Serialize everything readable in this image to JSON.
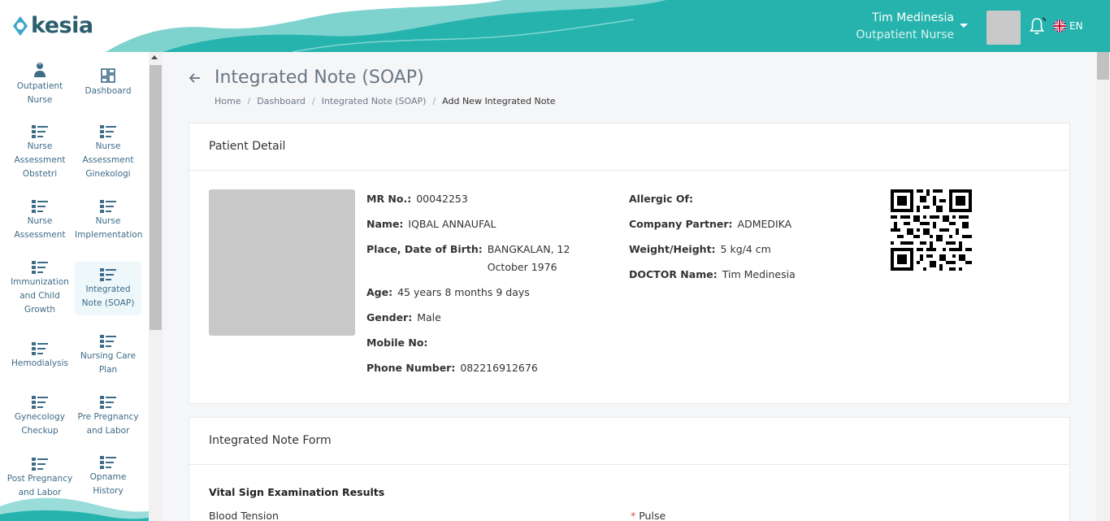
{
  "header": {
    "logo_text": "kesia",
    "user_name": "Tim Medinesia",
    "user_role": "Outpatient Nurse",
    "language": "EN",
    "colors": {
      "teal": "#27b3ad",
      "teal_light": "#7fd3cf"
    }
  },
  "sidebar": {
    "items": [
      {
        "label": "Outpatient Nurse",
        "icon": "nurse-icon",
        "active": false
      },
      {
        "label": "Dashboard",
        "icon": "dashboard-icon",
        "active": false
      },
      {
        "label": "Nurse Assessment Obstetri",
        "icon": "list-icon",
        "active": false
      },
      {
        "label": "Nurse Assessment Ginekologi",
        "icon": "list-icon",
        "active": false
      },
      {
        "label": "Nurse Assessment",
        "icon": "list-icon",
        "active": false
      },
      {
        "label": "Nurse Implementation",
        "icon": "list-icon",
        "active": false
      },
      {
        "label": "Immunization and Child Growth",
        "icon": "list-icon",
        "active": false
      },
      {
        "label": "Integrated Note (SOAP)",
        "icon": "list-icon",
        "active": true
      },
      {
        "label": "Hemodialysis",
        "icon": "list-icon",
        "active": false
      },
      {
        "label": "Nursing Care Plan",
        "icon": "list-icon",
        "active": false
      },
      {
        "label": "Gynecology Checkup",
        "icon": "list-icon",
        "active": false
      },
      {
        "label": "Pre Pregnancy and Labor",
        "icon": "list-icon",
        "active": false
      },
      {
        "label": "Post Pregnancy and Labor",
        "icon": "list-icon",
        "active": false
      },
      {
        "label": "Opname History",
        "icon": "list-icon",
        "active": false
      }
    ]
  },
  "page": {
    "title": "Integrated Note (SOAP)",
    "breadcrumb": [
      "Home",
      "Dashboard",
      "Integrated Note (SOAP)",
      "Add New Integrated Note"
    ]
  },
  "patient_card": {
    "title": "Patient Detail",
    "left_fields": [
      {
        "key": "MR No.:",
        "value": "00042253"
      },
      {
        "key": "Name:",
        "value": "IQBAL ANNAUFAL"
      },
      {
        "key": "Place, Date of Birth:",
        "value": "BANGKALAN, 12 October 1976"
      },
      {
        "key": "Age:",
        "value": "45 years 8 months 9 days"
      },
      {
        "key": "Gender:",
        "value": "Male"
      },
      {
        "key": "Mobile No:",
        "value": ""
      },
      {
        "key": "Phone Number:",
        "value": "082216912676"
      }
    ],
    "right_fields": [
      {
        "key": "Allergic Of:",
        "value": ""
      },
      {
        "key": "Company Partner:",
        "value": "ADMEDIKA"
      },
      {
        "key": "Weight/Height:",
        "value": "5 kg/4 cm"
      },
      {
        "key": "DOCTOR Name:",
        "value": "Tim Medinesia"
      }
    ]
  },
  "form_card": {
    "title": "Integrated Note Form",
    "section_title": "Vital Sign Examination Results",
    "blood_tension_label": "Blood Tension",
    "pulse_required_mark": "*",
    "pulse_label": "Pulse"
  }
}
